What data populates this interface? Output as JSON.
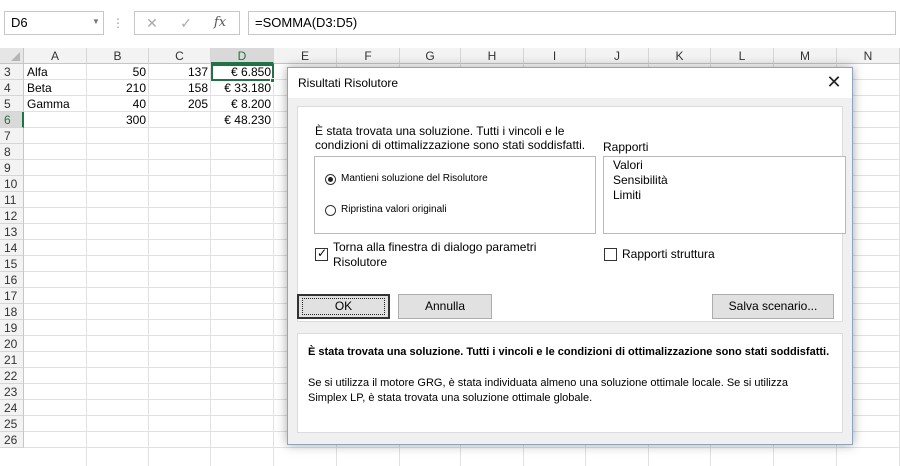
{
  "formula_bar": {
    "name_box": "D6",
    "formula": "=SOMMA(D3:D5)",
    "cancel_glyph": "✕",
    "enter_glyph": "✓",
    "fx_label": "fx"
  },
  "sheet": {
    "columns": [
      "A",
      "B",
      "C",
      "D",
      "E",
      "F",
      "G",
      "H",
      "I",
      "J",
      "K",
      "L",
      "M",
      "N"
    ],
    "active_column": "D",
    "rows": [
      "3",
      "4",
      "5",
      "6",
      "7",
      "8",
      "9",
      "10",
      "11",
      "12",
      "13",
      "14",
      "15",
      "16",
      "17",
      "18",
      "19",
      "20",
      "21",
      "22",
      "23",
      "24",
      "25",
      "26"
    ],
    "active_row": "6",
    "cells": {
      "A3": "Alfa",
      "B3": "50",
      "C3": "137",
      "D3": "€ 6.850",
      "A4": "Beta",
      "B4": "210",
      "C4": "158",
      "D4": "€ 33.180",
      "A5": "Gamma",
      "B5": "40",
      "C5": "205",
      "D5": "€ 8.200",
      "B6": "300",
      "D6": "€ 48.230"
    }
  },
  "dialog": {
    "title": "Risultati Risolutore",
    "close_glyph": "✕",
    "message": "È stata trovata una soluzione. Tutti i vincoli e le condizioni di ottimalizzazione sono stati soddisfatti.",
    "options": [
      {
        "label": "Mantieni soluzione del Risolutore",
        "selected": true
      },
      {
        "label": "Ripristina valori originali",
        "selected": false
      }
    ],
    "reports_label": "Rapporti",
    "reports": [
      "Valori",
      "Sensibilità",
      "Limiti"
    ],
    "return_checkbox": {
      "label": "Torna alla finestra di dialogo parametri Risolutore",
      "checked": true
    },
    "outline_checkbox": {
      "label": "Rapporti struttura",
      "checked": false
    },
    "buttons": {
      "ok": "OK",
      "cancel": "Annulla",
      "save": "Salva scenario..."
    },
    "description_title": "È stata trovata una soluzione. Tutti i vincoli e le condizioni di ottimalizzazione sono stati soddisfatti.",
    "description_text": "Se si utilizza il motore GRG, è stata individuata almeno una soluzione ottimale locale. Se si utilizza Simplex LP, è stata trovata una soluzione ottimale globale."
  },
  "colors": {
    "accent": "#217346",
    "dialog_border": "#8aa6c1",
    "dialog_bg": "#f0f0f0"
  }
}
